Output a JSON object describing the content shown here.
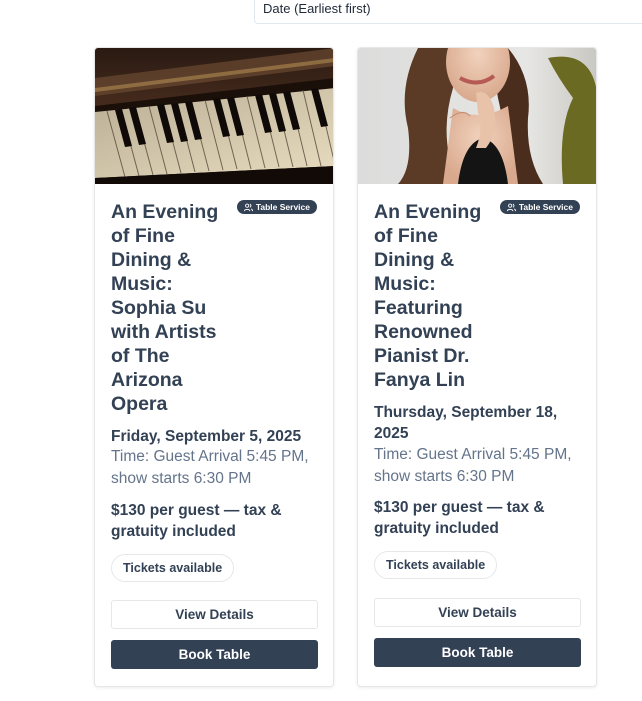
{
  "sort": {
    "value": "Date (Earliest first)"
  },
  "events": [
    {
      "image_desc": "piano-keys-photo",
      "badge": "Table Service",
      "title": "An Evening of Fine Dining & Music: Sophia Su with Artists of The Arizona Opera",
      "date": "Friday, September 5, 2025",
      "time": "Time: Guest Arrival 5:45 PM, show starts 6:30 PM",
      "price": "$130 per guest — tax & gratuity included",
      "availability": "Tickets available",
      "details_label": "View Details",
      "book_label": "Book Table"
    },
    {
      "image_desc": "pianist-portrait-photo",
      "badge": "Table Service",
      "title": "An Evening of Fine Dining & Music: Featuring Renowned Pianist Dr. Fanya Lin",
      "date": "Thursday, September 18, 2025",
      "time": "Time: Guest Arrival 5:45 PM, show starts 6:30 PM",
      "price": "$130 per guest — tax & gratuity included",
      "availability": "Tickets available",
      "details_label": "View Details",
      "book_label": "Book Table"
    }
  ],
  "colors": {
    "primary": "#334155",
    "muted": "#64748b",
    "border": "#e5e7eb"
  }
}
